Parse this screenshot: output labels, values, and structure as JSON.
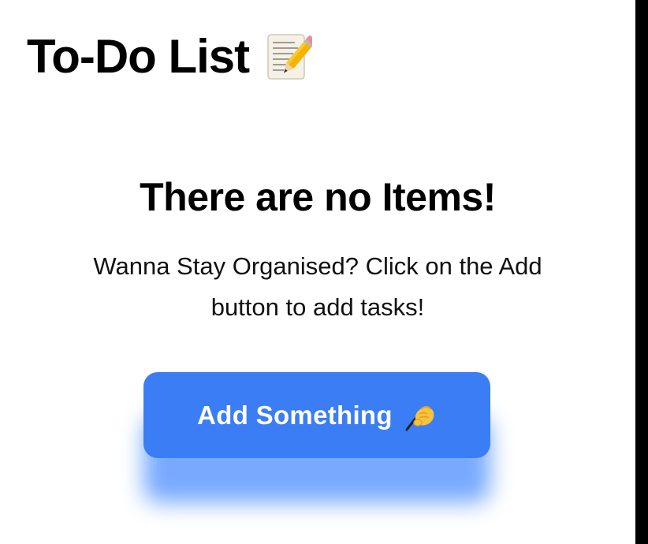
{
  "navigation": {
    "title": "To-Do List",
    "title_icon": "memo-icon"
  },
  "empty_state": {
    "title": "There are no Items!",
    "description": "Wanna Stay Organised? Click on the Add button to add tasks!",
    "button_label": "Add Something",
    "button_icon": "writing-hand-icon"
  },
  "colors": {
    "accent": "#3a7df5",
    "glow": "#5f9bff",
    "background": "#ffffff",
    "text": "#000000"
  }
}
